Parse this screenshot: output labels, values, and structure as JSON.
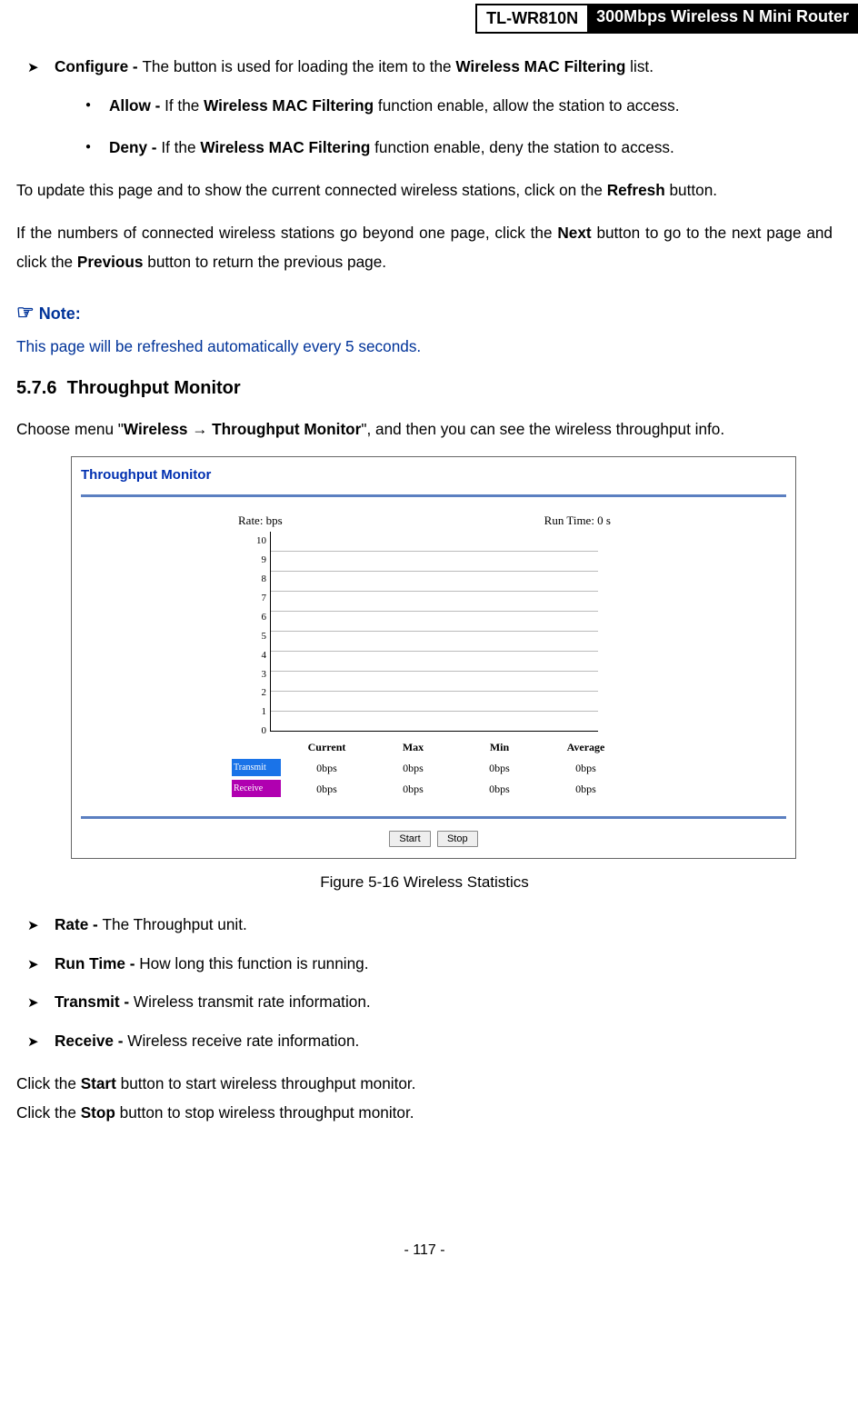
{
  "header": {
    "model": "TL-WR810N",
    "product": "300Mbps Wireless N Mini Router"
  },
  "configure": {
    "label": "Configure - ",
    "text1": "The button is used for loading the item to the ",
    "bold1": "Wireless MAC Filtering",
    "text2": " list."
  },
  "allow": {
    "label": "Allow - ",
    "text1": "If the ",
    "bold1": "Wireless MAC Filtering",
    "text2": " function enable, allow the station to access."
  },
  "deny": {
    "label": "Deny - ",
    "text1": "If the ",
    "bold1": "Wireless MAC Filtering",
    "text2": " function enable, deny the station to access."
  },
  "para1": {
    "t1": "To update this page and to show the current connected wireless stations, click on the ",
    "b1": "Refresh",
    "t2": " button."
  },
  "para2": {
    "t1": "If the numbers of connected wireless stations go beyond one page, click the ",
    "b1": "Next",
    "t2": " button to go to the next page and click the ",
    "b2": "Previous",
    "t3": " button to return the previous page."
  },
  "note": {
    "header": "Note:",
    "body": "This page will be refreshed automatically every 5 seconds."
  },
  "section": {
    "num": "5.7.6",
    "title": "Throughput Monitor"
  },
  "para3": {
    "t1": "Choose menu \"",
    "b1": "Wireless → Throughput Monitor",
    "t2": "\", and then you can see the wireless throughput info."
  },
  "chart_data": {
    "type": "line",
    "title": "Throughput Monitor",
    "rate_label": "Rate: bps",
    "runtime_label": "Run Time: 0 s",
    "y_ticks": [
      10,
      9,
      8,
      7,
      6,
      5,
      4,
      3,
      2,
      1,
      0
    ],
    "ylim": [
      0,
      10
    ],
    "xlabel": "",
    "ylabel": "",
    "series": [
      {
        "name": "Transmit",
        "values": []
      },
      {
        "name": "Receive",
        "values": []
      }
    ],
    "stats_header": [
      "Current",
      "Max",
      "Min",
      "Average"
    ],
    "stats_rows": [
      {
        "label": "Transmit",
        "values": [
          "0bps",
          "0bps",
          "0bps",
          "0bps"
        ]
      },
      {
        "label": "Receive",
        "values": [
          "0bps",
          "0bps",
          "0bps",
          "0bps"
        ]
      }
    ],
    "buttons": {
      "start": "Start",
      "stop": "Stop"
    }
  },
  "fig_caption": "Figure 5-16 Wireless Statistics",
  "defs": {
    "rate": {
      "label": "Rate - ",
      "text": "The Throughput unit."
    },
    "runtime": {
      "label": "Run Time - ",
      "text": "How long this function is running."
    },
    "transmit": {
      "label": "Transmit - ",
      "text": "Wireless transmit rate information."
    },
    "receive": {
      "label": "Receive - ",
      "text": "Wireless receive rate information."
    }
  },
  "para4": {
    "t1": "Click the ",
    "b1": "Start",
    "t2": " button to start wireless throughput monitor."
  },
  "para5": {
    "t1": "Click the ",
    "b1": "Stop",
    "t2": " button to stop wireless throughput monitor."
  },
  "page_num": "- 117 -"
}
